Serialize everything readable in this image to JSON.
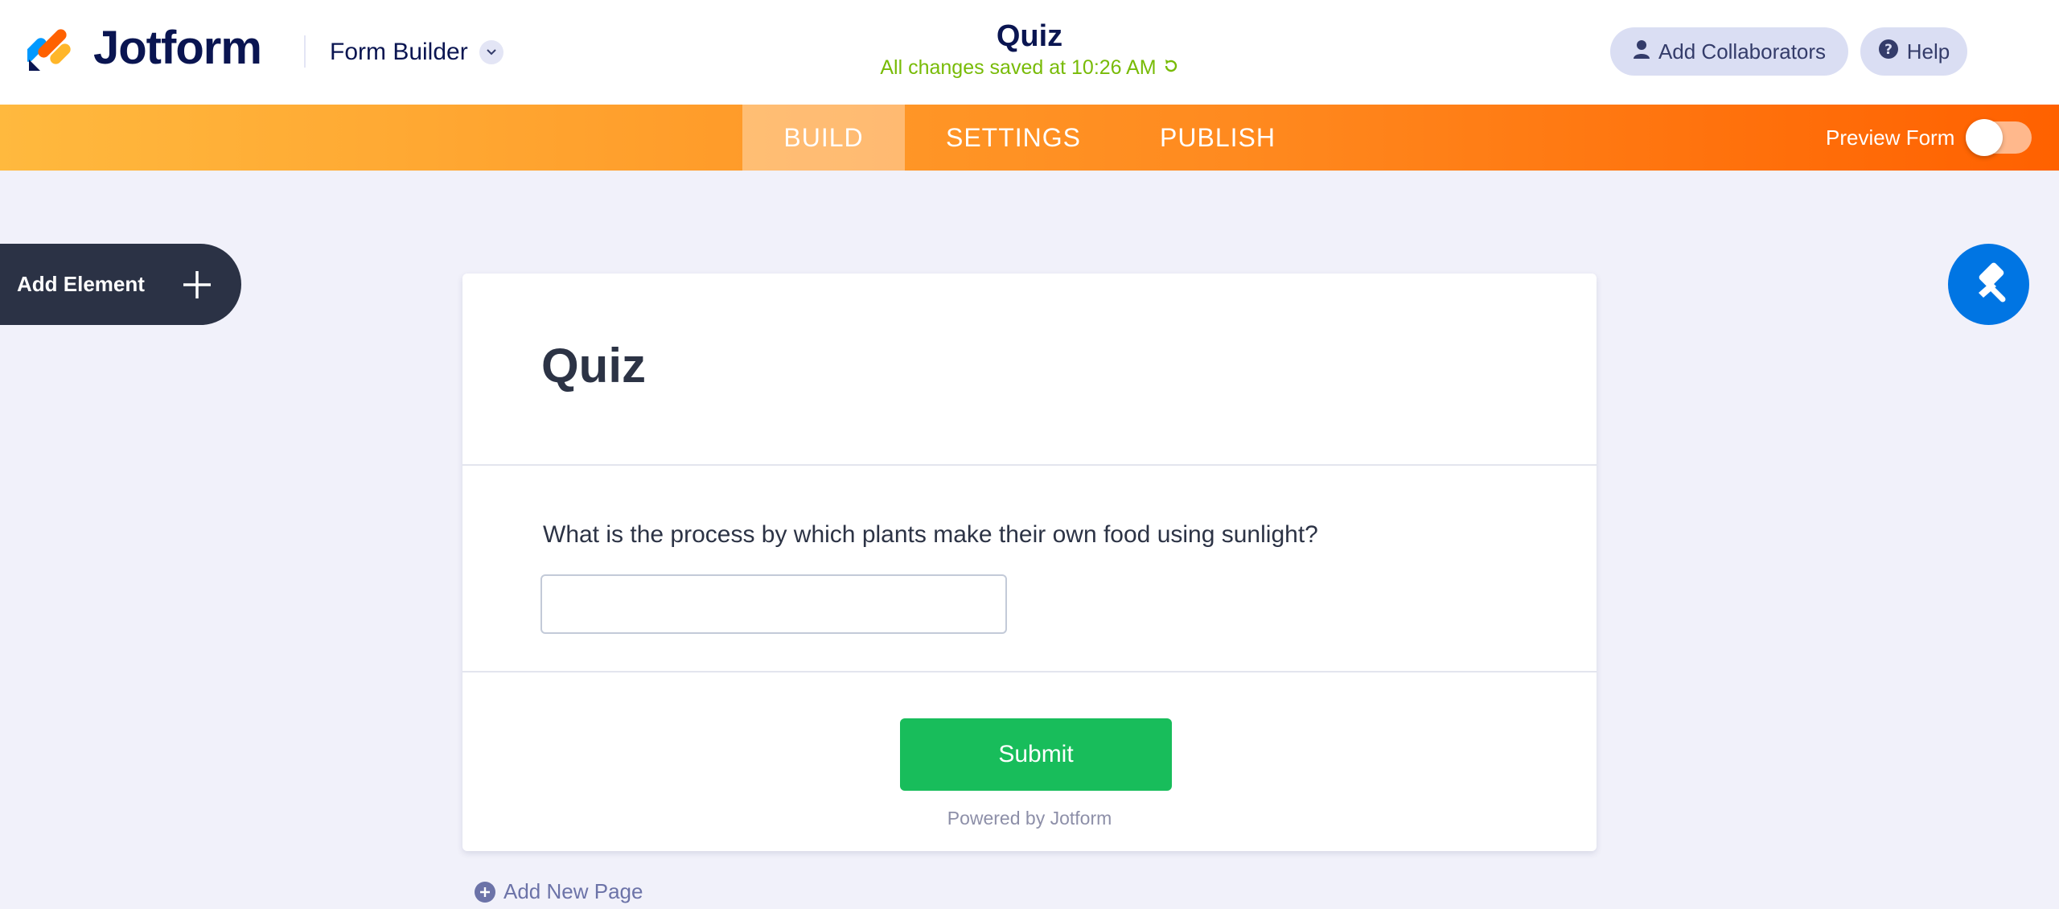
{
  "header": {
    "logo_text": "Jotform",
    "builder_label": "Form Builder",
    "form_title": "Quiz",
    "save_status": "All changes saved at 10:26 AM",
    "collaborators_label": "Add Collaborators",
    "help_label": "Help"
  },
  "nav": {
    "tabs": [
      {
        "label": "BUILD",
        "active": true
      },
      {
        "label": "SETTINGS",
        "active": false
      },
      {
        "label": "PUBLISH",
        "active": false
      }
    ],
    "preview_label": "Preview Form",
    "preview_enabled": false
  },
  "sidebar": {
    "add_element_label": "Add Element"
  },
  "form": {
    "heading": "Quiz",
    "question": "What is the process by which plants make their own food using sunlight?",
    "answer_value": "",
    "submit_label": "Submit",
    "powered_by": "Powered by Jotform"
  },
  "footer": {
    "add_page_label": "Add New Page"
  },
  "colors": {
    "brand_navy": "#0a1551",
    "nav_orange_start": "#ffb93e",
    "nav_orange_end": "#ff6100",
    "submit_green": "#18bd5b",
    "designer_blue": "#0075e3",
    "saved_green": "#78bb07"
  }
}
